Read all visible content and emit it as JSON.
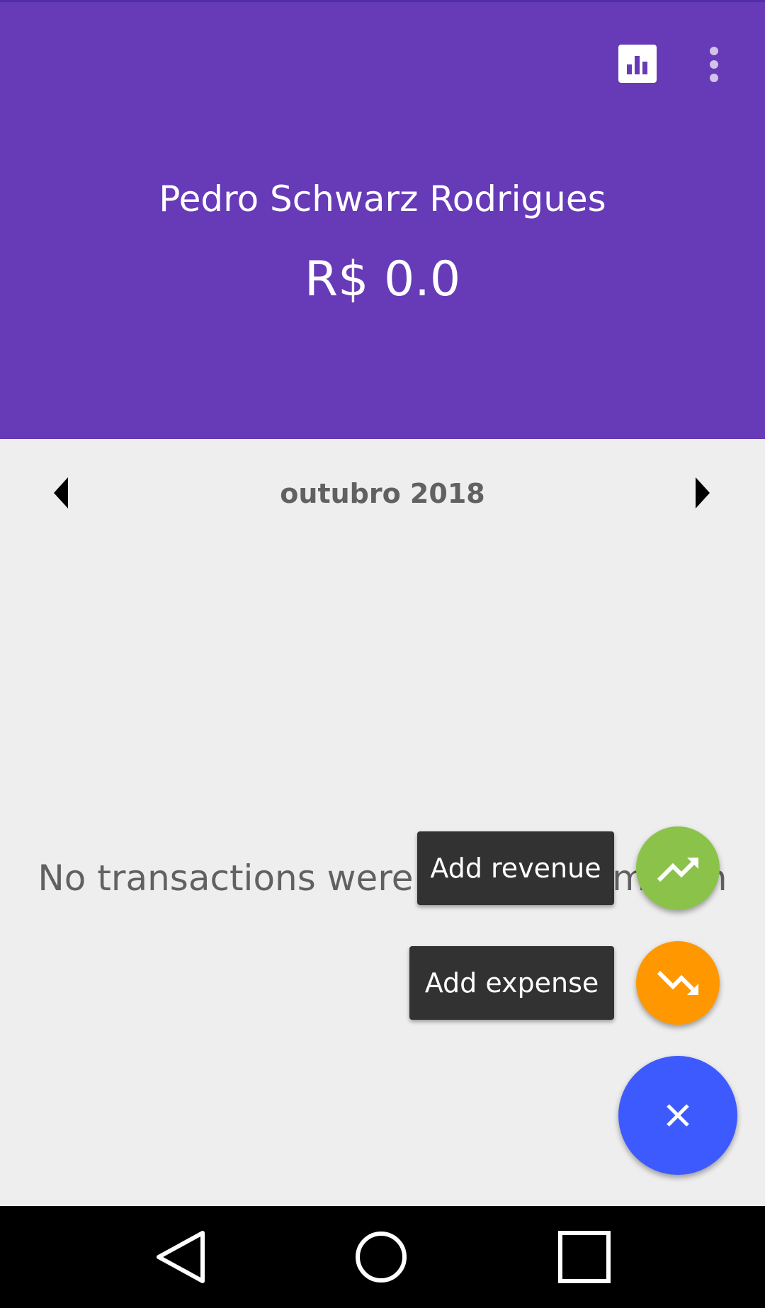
{
  "header": {
    "user_name": "Pedro Schwarz Rodrigues",
    "balance": "R$ 0.0",
    "actions": {
      "chart_icon": "bar-chart-icon",
      "more_icon": "more-vert-icon"
    }
  },
  "month_nav": {
    "label": "outubro 2018",
    "prev_icon": "arrow-left-icon",
    "next_icon": "arrow-right-icon"
  },
  "empty_state": {
    "message": "No transactions were made this month"
  },
  "fab_menu": {
    "revenue_label": "Add revenue",
    "expense_label": "Add expense",
    "revenue_icon": "trending-up-icon",
    "expense_icon": "trending-down-icon",
    "close_icon": "close-icon"
  },
  "colors": {
    "header": "#673ab7",
    "background": "#eeeeee",
    "revenue": "#8bc34a",
    "expense": "#ff9800",
    "main_fab": "#3d5afe"
  },
  "system_nav": {
    "back_icon": "back-icon",
    "home_icon": "home-icon",
    "recents_icon": "recents-icon"
  }
}
